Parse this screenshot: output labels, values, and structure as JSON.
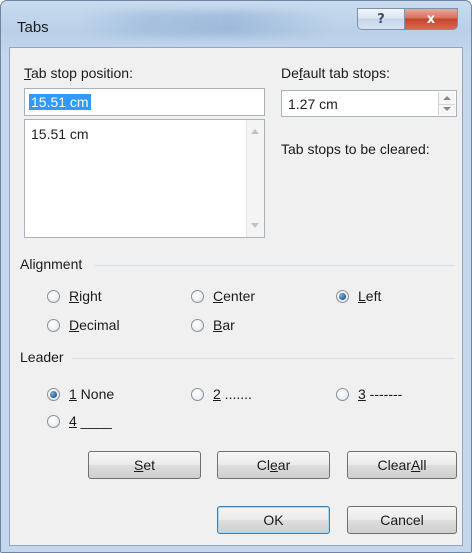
{
  "window": {
    "title": "Tabs",
    "help_label": "?",
    "close_label": "x"
  },
  "tab_stop_position": {
    "label_accel": "T",
    "label_rest": "ab stop position:",
    "value": "15.51 cm",
    "list_items": [
      "15.51 cm"
    ]
  },
  "default_tab_stops": {
    "label_pre": "De",
    "label_accel": "f",
    "label_rest": "ault tab stops:",
    "value": "1.27 cm"
  },
  "tab_stops_to_clear": {
    "label": "Tab stops to be cleared:"
  },
  "alignment": {
    "heading": "Alignment",
    "options": [
      {
        "accel": "R",
        "rest": "ight",
        "selected": false
      },
      {
        "pre": "",
        "accel": "C",
        "rest": "enter",
        "selected": false
      },
      {
        "accel": "L",
        "rest": "eft",
        "selected": true
      },
      {
        "accel": "D",
        "rest": "ecimal",
        "selected": false
      },
      {
        "accel": "B",
        "rest": "ar",
        "selected": false
      }
    ]
  },
  "leader": {
    "heading": "Leader",
    "options": [
      {
        "accel": "1",
        "rest": " None",
        "selected": true
      },
      {
        "accel": "2",
        "rest": " .......",
        "selected": false
      },
      {
        "accel": "3",
        "rest": " -------",
        "selected": false
      },
      {
        "accel": "4",
        "rest": " ____",
        "selected": false
      }
    ]
  },
  "buttons": {
    "set_accel": "S",
    "set_rest": "et",
    "clear_pre": "Cl",
    "clear_accel": "e",
    "clear_rest": "ar",
    "clear_all_pre": "Clear ",
    "clear_all_accel": "A",
    "clear_all_rest": "ll",
    "ok": "OK",
    "cancel": "Cancel"
  },
  "colors": {
    "selection": "#3399ff",
    "title_bar": "#b9d0e8",
    "close_button": "#c8442a",
    "dialog_bg": "#f0f0f0"
  }
}
